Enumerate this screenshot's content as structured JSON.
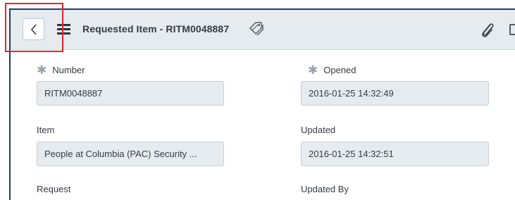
{
  "header": {
    "back_button": "back",
    "title": "Requested Item - RITM0048887"
  },
  "fields": {
    "number": {
      "label": "Number",
      "value": "RITM0048887",
      "mandatory": true
    },
    "opened": {
      "label": "Opened",
      "value": "2016-01-25 14:32:49",
      "mandatory": true
    },
    "item": {
      "label": "Item",
      "value": "People at Columbia (PAC) Security ..."
    },
    "updated": {
      "label": "Updated",
      "value": "2016-01-25 14:32:51"
    },
    "request": {
      "label": "Request"
    },
    "updated_by": {
      "label": "Updated By"
    }
  },
  "icons": [
    "chevron-left-icon",
    "hamburger-menu-icon",
    "tags-icon",
    "paperclip-icon"
  ],
  "colors": {
    "header_bg": "#e6ebef",
    "field_bg": "#e6ebef",
    "frame_border": "#1d3c66",
    "annotation_box": "#e8232a",
    "mandatory_star": "#9aa3ab"
  }
}
